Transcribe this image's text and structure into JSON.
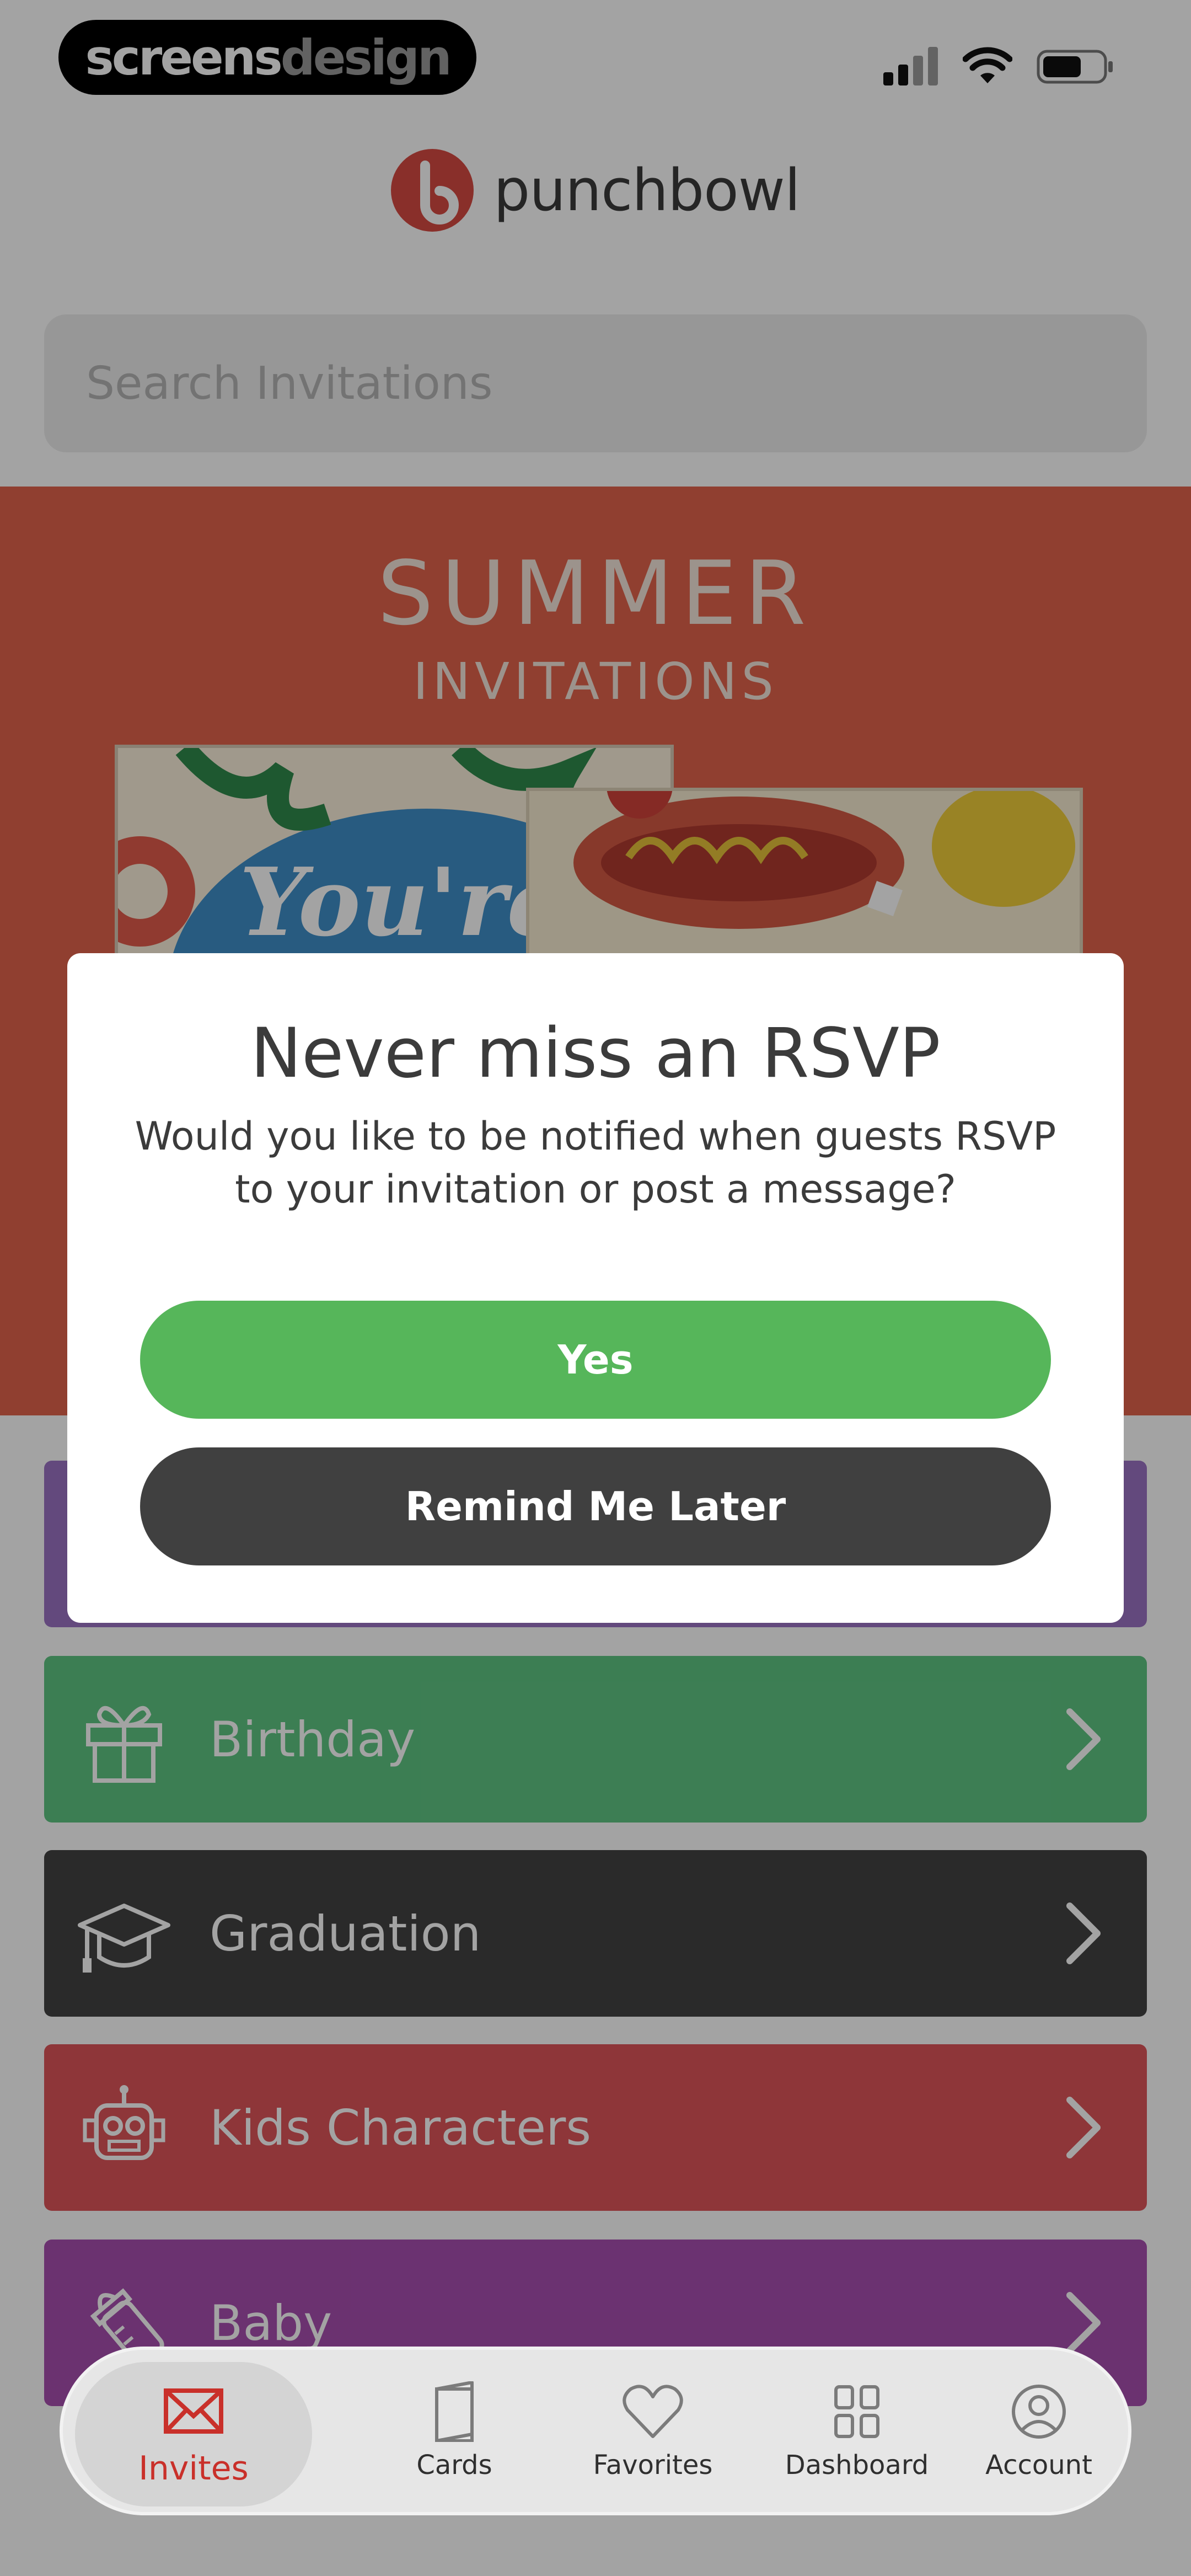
{
  "status_bar": {
    "badge_part1": "screens",
    "badge_part2": "design",
    "icons": [
      "signal-icon",
      "wifi-icon",
      "battery-icon"
    ]
  },
  "header": {
    "logo_text": "punchbowl"
  },
  "search": {
    "placeholder": "Search Invitations"
  },
  "banner": {
    "title": "SUMMER",
    "subtitle": "INVITATIONS",
    "card_text": "You're"
  },
  "categories": [
    {
      "label": "",
      "icon": "unknown-icon",
      "color": "#9b72c4"
    },
    {
      "label": "Birthday",
      "icon": "gift-icon",
      "color": "#5fc583"
    },
    {
      "label": "Graduation",
      "icon": "graduation-cap-icon",
      "color": "#424242"
    },
    {
      "label": "Kids Characters",
      "icon": "robot-icon",
      "color": "#de5559"
    },
    {
      "label": "Baby",
      "icon": "baby-bottle-icon",
      "color": "#a84fb0"
    }
  ],
  "dialog": {
    "title": "Never miss an RSVP",
    "message": "Would you like to be notified when guests RSVP to your invitation or post a message?",
    "yes_label": "Yes",
    "later_label": "Remind Me Later",
    "yes_color": "#56b65a",
    "later_color": "#404040"
  },
  "tabbar": {
    "tabs": [
      {
        "label": "Invites",
        "icon": "envelope-icon",
        "active": true
      },
      {
        "label": "Cards",
        "icon": "card-icon",
        "active": false
      },
      {
        "label": "Favorites",
        "icon": "heart-icon",
        "active": false
      },
      {
        "label": "Dashboard",
        "icon": "grid-icon",
        "active": false
      },
      {
        "label": "Account",
        "icon": "account-icon",
        "active": false
      }
    ],
    "active_color": "#c9302a"
  }
}
